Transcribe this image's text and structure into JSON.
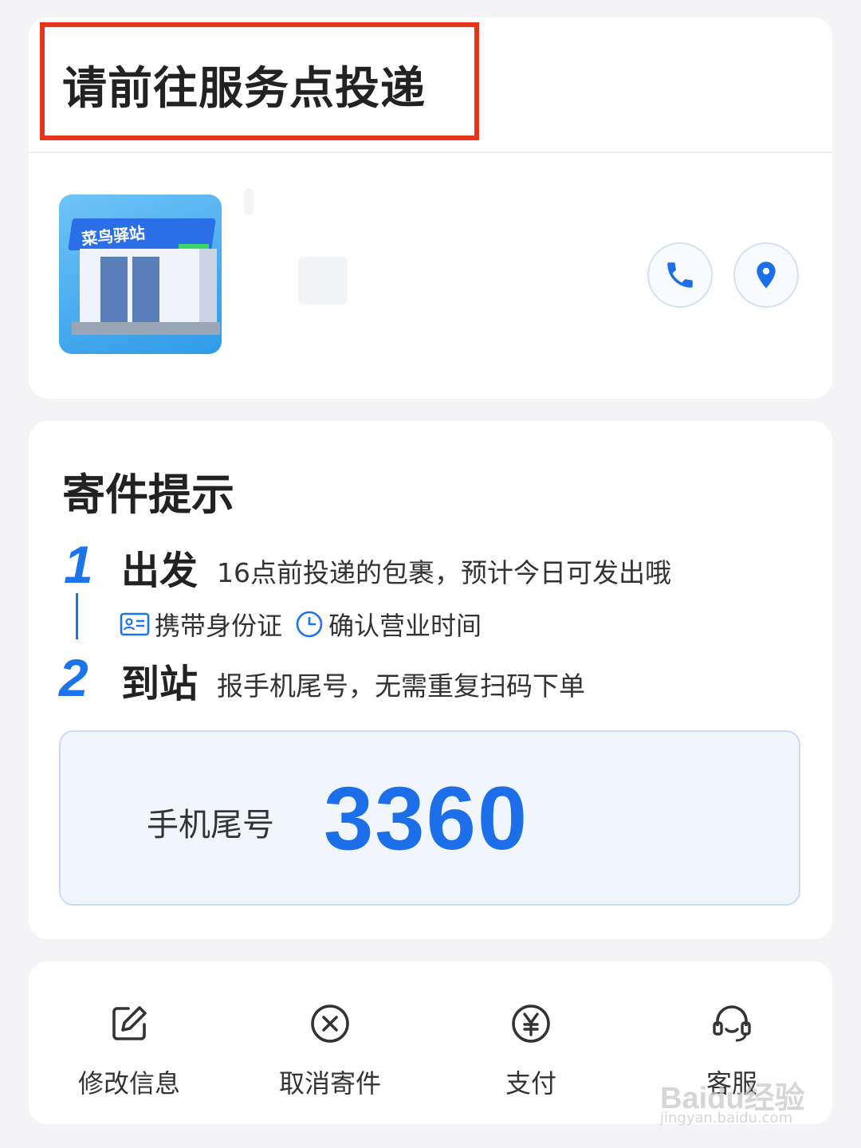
{
  "header": {
    "title": "请前往服务点投递"
  },
  "station": {
    "image_label": "菜鸟驿站",
    "phone_icon": "phone-icon",
    "location_icon": "location-pin-icon"
  },
  "tips": {
    "title": "寄件提示",
    "steps": [
      {
        "number": "1",
        "heading": "出发",
        "description": "16点前投递的包裹，预计今日可发出哦",
        "tags": [
          {
            "icon": "id-card-icon",
            "label": "携带身份证"
          },
          {
            "icon": "clock-icon",
            "label": "确认营业时间"
          }
        ]
      },
      {
        "number": "2",
        "heading": "到站",
        "description": "报手机尾号，无需重复扫码下单"
      }
    ],
    "phone_tail": {
      "label": "手机尾号",
      "value": "3360"
    }
  },
  "actions": [
    {
      "icon": "edit-icon",
      "label": "修改信息"
    },
    {
      "icon": "cancel-icon",
      "label": "取消寄件"
    },
    {
      "icon": "yuan-icon",
      "label": "支付"
    },
    {
      "icon": "headset-icon",
      "label": "客服"
    }
  ],
  "watermark": {
    "brand": "Baidu经验",
    "url": "jingyan.baidu.com"
  },
  "colors": {
    "accent": "#1c74e9",
    "highlight_border": "#e8351a",
    "background": "#f4f4f6"
  }
}
